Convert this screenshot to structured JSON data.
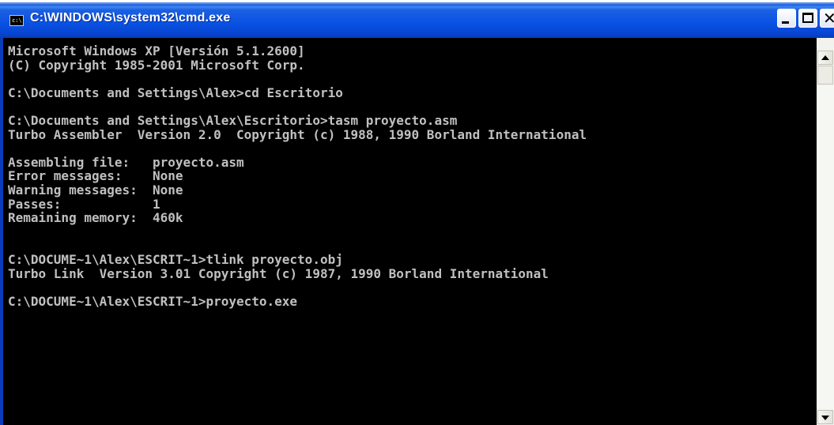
{
  "window": {
    "title": "C:\\WINDOWS\\system32\\cmd.exe",
    "icon": "cmd-console-icon",
    "icon_text": "c:\\"
  },
  "console": {
    "lines": [
      "Microsoft Windows XP [Versión 5.1.2600]",
      "(C) Copyright 1985-2001 Microsoft Corp.",
      "",
      "C:\\Documents and Settings\\Alex>cd Escritorio",
      "",
      "C:\\Documents and Settings\\Alex\\Escritorio>tasm proyecto.asm",
      "Turbo Assembler  Version 2.0  Copyright (c) 1988, 1990 Borland International",
      "",
      "Assembling file:   proyecto.asm",
      "Error messages:    None",
      "Warning messages:  None",
      "Passes:            1",
      "Remaining memory:  460k",
      "",
      "",
      "C:\\DOCUME~1\\Alex\\ESCRIT~1>tlink proyecto.obj",
      "Turbo Link  Version 3.01 Copyright (c) 1987, 1990 Borland International",
      "",
      "C:\\DOCUME~1\\Alex\\ESCRIT~1>proyecto.exe"
    ]
  },
  "colors": {
    "console_bg": "#000000",
    "console_fg": "#c0c0c0",
    "titlebar": "#0a53e4"
  }
}
